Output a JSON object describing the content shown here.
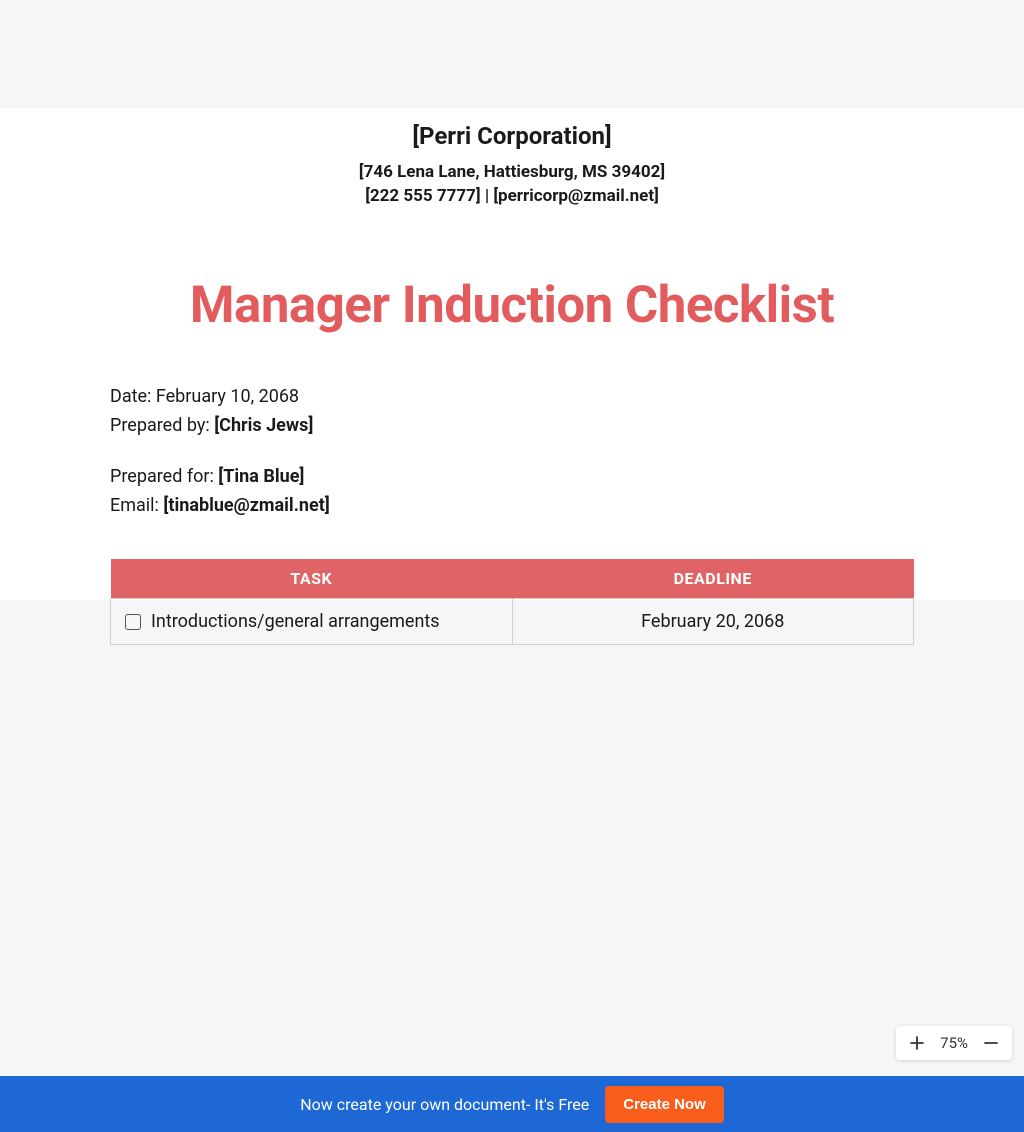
{
  "company": {
    "name": "[Perri Corporation]",
    "address": "[746 Lena Lane, Hattiesburg, MS 39402]",
    "phone": "[222 555 7777]",
    "email": "[perricorp@zmail.net]"
  },
  "title": "Manager Induction Checklist",
  "meta": {
    "date_label": "Date: ",
    "date_value": "February 10, 2068",
    "prepared_by_label": "Prepared by: ",
    "prepared_by_value": "[Chris Jews]",
    "prepared_for_label": "Prepared for: ",
    "prepared_for_value": "[Tina Blue]",
    "email_label": "Email: ",
    "email_value": "[tinablue@zmail.net]"
  },
  "table": {
    "headers": {
      "task": "TASK",
      "deadline": "DEADLINE"
    },
    "rows": [
      {
        "task": "Introductions/general arrangements",
        "deadline": "February 20, 2068"
      }
    ]
  },
  "zoom": {
    "level": "75%"
  },
  "banner": {
    "text": "Now create your own document- It's Free",
    "button": "Create Now"
  },
  "separator": " | "
}
